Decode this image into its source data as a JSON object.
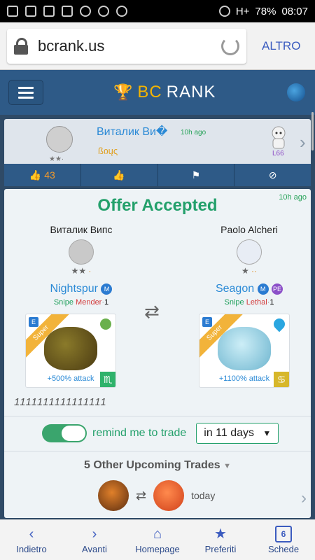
{
  "status_bar": {
    "battery": "78%",
    "time": "08:07",
    "signal": "H+"
  },
  "browser": {
    "url": "bcrank.us",
    "menu_label": "ALTRO"
  },
  "app": {
    "brand_first": "BC",
    "brand_second": "RANK"
  },
  "trade_row": {
    "user_name": "Виталик Ви�",
    "time": "10h ago",
    "user_title": "ßიųς",
    "level": "L66",
    "likes": "43"
  },
  "offer": {
    "time": "10h ago",
    "title": "Offer Accepted",
    "left": {
      "name": "Виталик Випс",
      "pet": "Nightspur",
      "badges": [
        "M"
      ],
      "role": "Snipe",
      "trait": "Mender",
      "tier": "1",
      "ribbon": "Super",
      "attack": "+500% attack",
      "zodiac": "♏"
    },
    "right": {
      "name": "Paolo Alcheri",
      "pet": "Seagon",
      "badges": [
        "M",
        "PE"
      ],
      "role": "Snipe",
      "trait": "Lethal",
      "tier": "1",
      "ribbon": "Super",
      "attack": "+1100% attack",
      "zodiac": "♋"
    },
    "note": "1111111111111111",
    "remind_label": "remind me to trade",
    "remind_select": "in 11 days",
    "upcoming_title": "5 Other Upcoming Trades",
    "upcoming_when": "today"
  },
  "nav": {
    "back": "Indietro",
    "forward": "Avanti",
    "home": "Homepage",
    "favorites": "Preferiti",
    "tabs": "Schede",
    "tab_count": "6"
  }
}
